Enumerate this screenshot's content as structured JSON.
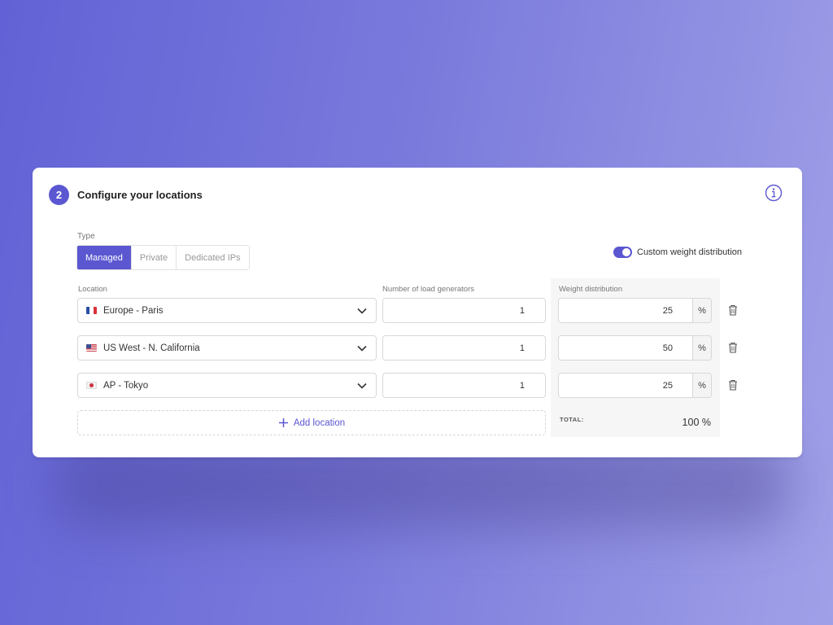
{
  "colors": {
    "accent": "#5b57d1",
    "background_start": "#6262d6",
    "background_end": "#a0a0e8"
  },
  "card": {
    "step_number": "2",
    "title": "Configure your locations",
    "info_icon": "info-circle-icon"
  },
  "type": {
    "label": "Type",
    "options": [
      {
        "label": "Managed",
        "active": true
      },
      {
        "label": "Private",
        "active": false
      },
      {
        "label": "Dedicated IPs",
        "active": false
      }
    ]
  },
  "custom_weight": {
    "label": "Custom weight distribution",
    "enabled": true
  },
  "columns": {
    "location": "Location",
    "load_generators": "Number of load generators",
    "weight": "Weight distribution"
  },
  "rows": [
    {
      "flag": "fr",
      "location": "Europe - Paris",
      "load_generators": "1",
      "weight": "25",
      "unit": "%"
    },
    {
      "flag": "us",
      "location": "US West - N. California",
      "load_generators": "1",
      "weight": "50",
      "unit": "%"
    },
    {
      "flag": "jp",
      "location": "AP - Tokyo",
      "load_generators": "1",
      "weight": "25",
      "unit": "%"
    }
  ],
  "add_location": {
    "label": "Add location",
    "icon": "plus-icon"
  },
  "total": {
    "label": "TOTAL:",
    "value": "100 %"
  }
}
